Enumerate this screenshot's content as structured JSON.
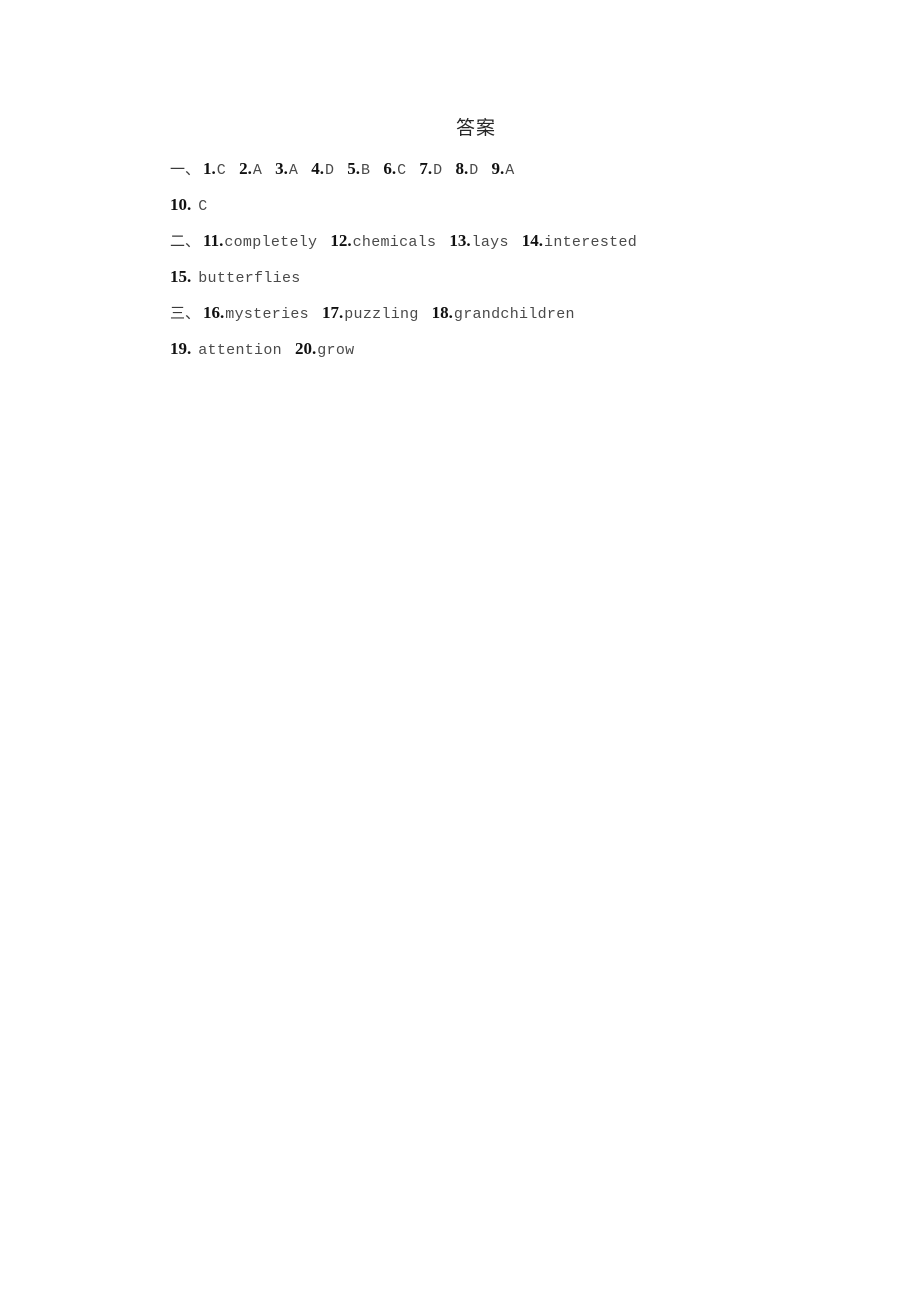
{
  "document": {
    "title": "答案",
    "background_color": "#ffffff",
    "text_color": "#1a1a1a"
  },
  "sections": [
    {
      "marker": "一、",
      "lines": [
        {
          "has_marker": true,
          "items": [
            {
              "num": "1.",
              "value": "C"
            },
            {
              "num": "2.",
              "value": "A"
            },
            {
              "num": "3.",
              "value": "A"
            },
            {
              "num": "4.",
              "value": "D"
            },
            {
              "num": "5.",
              "value": "B"
            },
            {
              "num": "6.",
              "value": "C"
            },
            {
              "num": "7.",
              "value": "D"
            },
            {
              "num": "8.",
              "value": "D"
            },
            {
              "num": "9.",
              "value": "A"
            }
          ]
        },
        {
          "has_marker": false,
          "items": [
            {
              "num": "10.",
              "value": "C",
              "wide": true
            }
          ]
        }
      ]
    },
    {
      "marker": "二、",
      "lines": [
        {
          "has_marker": true,
          "items": [
            {
              "num": "11.",
              "value": "completely"
            },
            {
              "num": "12.",
              "value": "chemicals"
            },
            {
              "num": "13.",
              "value": "lays"
            },
            {
              "num": "14.",
              "value": "interested"
            }
          ]
        },
        {
          "has_marker": false,
          "items": [
            {
              "num": "15.",
              "value": "butterflies",
              "wide": true
            }
          ]
        }
      ]
    },
    {
      "marker": "三、",
      "lines": [
        {
          "has_marker": true,
          "items": [
            {
              "num": "16.",
              "value": "mysteries"
            },
            {
              "num": "17.",
              "value": "puzzling"
            },
            {
              "num": "18.",
              "value": "grandchildren"
            }
          ]
        },
        {
          "has_marker": false,
          "items": [
            {
              "num": "19.",
              "value": "attention",
              "wide": true
            },
            {
              "num": "20.",
              "value": "grow"
            }
          ]
        }
      ]
    }
  ]
}
